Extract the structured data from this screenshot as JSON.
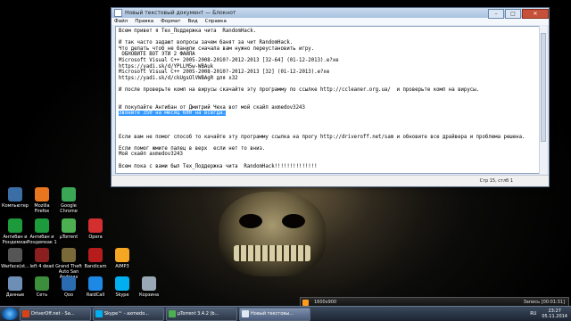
{
  "window": {
    "title": "Новый текстовый документ — Блокнот",
    "menu": [
      "Файл",
      "Правка",
      "Формат",
      "Вид",
      "Справка"
    ],
    "status": "Стр 15, стлб 1"
  },
  "document": {
    "lines": [
      "Всем привет я Тех_Поддержка чита  RandomHack.",
      "",
      "И так часто задают вопросы зачем банят за чит RandomHack.",
      "Что делать чтоб не банили сначала вам нужно переустановить игру.",
      " ОБНОВИТЕ ВОТ ЭТИ 2 ФАЙЛА",
      "Microsoft Visual C++ 2005-2008-2010?-2012-2013 [32-64] (01-12-2013).e?xe",
      "https://yadi.sk/d/YPLLM5w-WBAuk",
      "Microsoft Visual C++ 2005-2008-2010?-2012-2013 [32] (01-12-2013).e?xe",
      "https://yadi.sk/d/ckUgsOlVWBAgR для x32",
      "",
      "И после проверьте комп на вирусы скачайте эту программу по ссылке http://ccleaner.org.ua/  и проверьте комп на вирусы.",
      "",
      "",
      "И покупайте Антибан от Дмитрий Чеха вот мой скайп axmedov3243",
      "Звоните 350 на месяц 600 на всегда.",
      "",
      "",
      "",
      "Если вам не помог способ то качайте эту программу ссылка на прогу http://driveroff.net/sam и обновите все драйвера и проблема решена.",
      "",
      "Если помог жмите палец в верх  если нет то вниз.",
      "Мой скайп axmedov3243",
      "",
      "Всем пока с вами был Тех_Поддержка чита  RandomHack!!!!!!!!!!!!!!"
    ],
    "selected_line_index": 14
  },
  "desktop_icons": [
    {
      "label": "Компьютер",
      "color": "#3a6ea5"
    },
    {
      "label": "Mozilla Firefox",
      "color": "#e8761e"
    },
    {
      "label": "Google Chrome",
      "color": "#3aa757"
    },
    {
      "label": "Антибан и Рондемхак",
      "color": "#1d9a3c"
    },
    {
      "label": "Антибан и Рондемхак 1",
      "color": "#1d9a3c"
    },
    {
      "label": "µTorrent",
      "color": "#4caf50"
    },
    {
      "label": "Opera",
      "color": "#d32f2f"
    },
    {
      "label": "Warface(st...",
      "color": "#555"
    },
    {
      "label": "left 4 dead",
      "color": "#8b1e1e"
    },
    {
      "label": "Grand Theft Auto San Andreas",
      "color": "#7a6a3a"
    },
    {
      "label": "Bandicam",
      "color": "#b71c1c"
    },
    {
      "label": "AIMP3",
      "color": "#f5a623"
    },
    {
      "label": "Данные",
      "color": "#6d8fb5"
    },
    {
      "label": "Сеть",
      "color": "#3c8d3c"
    },
    {
      "label": "Qoo",
      "color": "#2b6cb0"
    },
    {
      "label": "RaidCall",
      "color": "#1e88e5"
    },
    {
      "label": "Skype",
      "color": "#00aff0"
    },
    {
      "label": "Корзина",
      "color": "#9aa7b5"
    }
  ],
  "taskbar": {
    "tasks": [
      {
        "label": "DriverOff.net - Sa...",
        "color": "#d84315",
        "active": false
      },
      {
        "label": "Skype™ - axmedo...",
        "color": "#00aff0",
        "active": false
      },
      {
        "label": "µTorrent 3.4.2 (b...",
        "color": "#4caf50",
        "active": false
      },
      {
        "label": "Новый текстовы...",
        "color": "#e0e8f2",
        "active": true
      }
    ],
    "language": "RU",
    "time": "23:27",
    "date": "05.11.2014"
  },
  "media_bar": {
    "resolution": "1600x900",
    "record_label": "Запись [00:01:31]"
  }
}
